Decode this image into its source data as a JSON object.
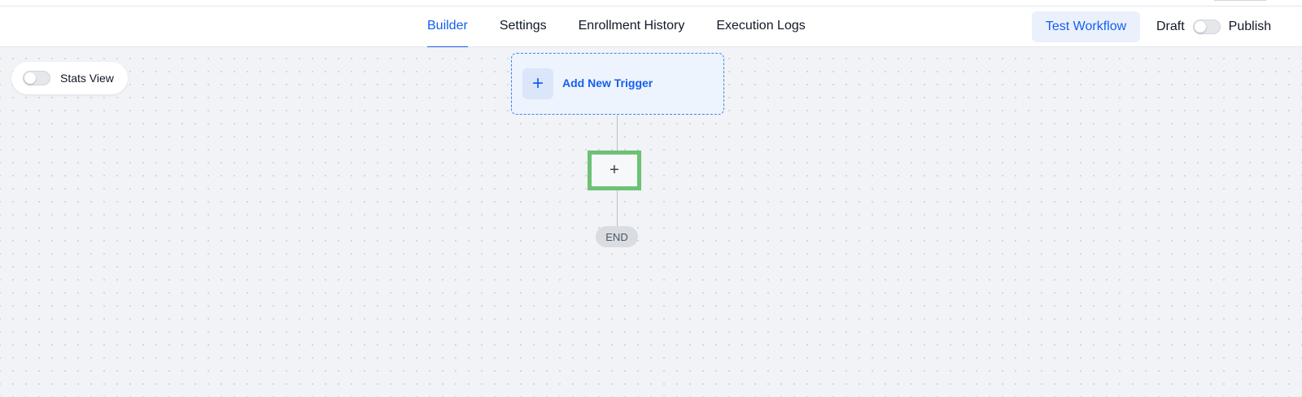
{
  "header": {
    "tabs": [
      {
        "label": "Builder",
        "active": true
      },
      {
        "label": "Settings",
        "active": false
      },
      {
        "label": "Enrollment History",
        "active": false
      },
      {
        "label": "Execution Logs",
        "active": false
      }
    ],
    "test_workflow_label": "Test Workflow",
    "draft_label": "Draft",
    "publish_label": "Publish",
    "publish_toggle_on": false
  },
  "canvas": {
    "stats_view_label": "Stats View",
    "stats_view_on": false,
    "trigger": {
      "plus_glyph": "+",
      "label": "Add New Trigger",
      "icon": "plus-icon"
    },
    "add_step": {
      "glyph": "+",
      "icon": "plus-icon",
      "highlight_color": "#6cc275"
    },
    "end_label": "END"
  },
  "colors": {
    "accent": "#155eef",
    "canvas_bg": "#f1f3f6",
    "trigger_border": "#3b82f6"
  }
}
